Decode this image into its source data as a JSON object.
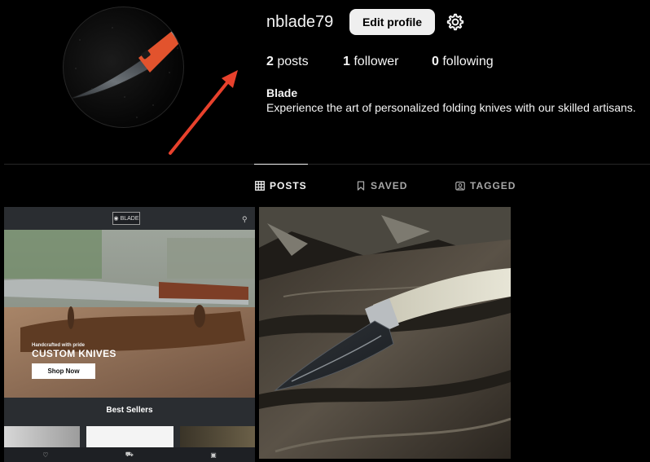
{
  "profile": {
    "username": "nblade79",
    "edit_label": "Edit profile",
    "settings_icon": "gear-icon",
    "stats": {
      "posts_count": "2",
      "posts_label": "posts",
      "followers_count": "1",
      "followers_label": "follower",
      "following_count": "0",
      "following_label": "following"
    },
    "bio_name": "Blade",
    "bio_text": "Experience the art of personalized folding knives with our skilled artisans."
  },
  "tabs": [
    {
      "label": "POSTS",
      "icon": "grid-icon",
      "active": true
    },
    {
      "label": "SAVED",
      "icon": "bookmark-icon",
      "active": false
    },
    {
      "label": "TAGGED",
      "icon": "tag-portrait-icon",
      "active": false
    }
  ],
  "posts": {
    "post1": {
      "logo_text": "BLADE",
      "hero_small": "Handcrafted with pride",
      "hero_title": "CUSTOM KNIVES",
      "shop_btn": "Shop Now",
      "section_title": "Best Sellers"
    }
  },
  "colors": {
    "background": "#000000",
    "annotation_arrow": "#e8412c",
    "button_bg": "#efefef"
  }
}
